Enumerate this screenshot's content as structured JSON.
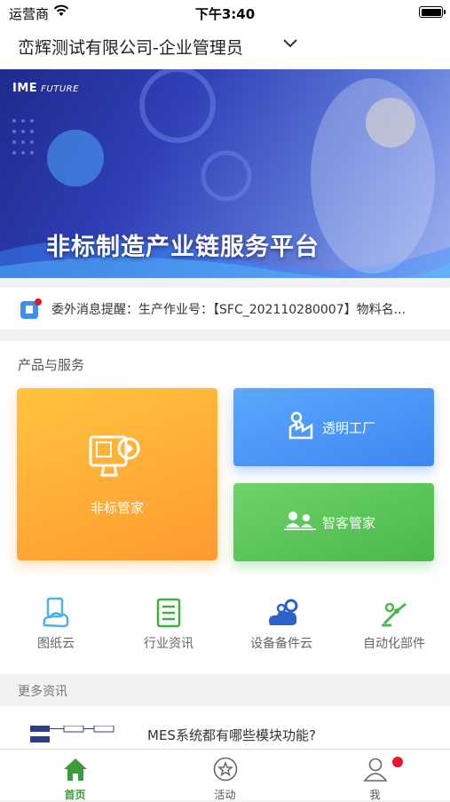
{
  "status_bar": {
    "carrier": "运营商",
    "time": "下午3:40"
  },
  "header": {
    "company": "峦辉测试有限公司-企业管理员"
  },
  "banner": {
    "logo": "IME",
    "logo_sub": "FUTURE",
    "title": "非标制造产业链服务平台"
  },
  "notice": {
    "text": "委外消息提醒：生产作业号：【SFC_202110280007】物料名..."
  },
  "products": {
    "title": "产品与服务",
    "cards": {
      "main": "非标管家",
      "factory": "透明工厂",
      "crm": "智客管家"
    },
    "quick": [
      "图纸云",
      "行业资讯",
      "设备备件云",
      "自动化部件"
    ]
  },
  "more": {
    "title": "更多资讯",
    "article_title": "MES系统都有哪些模块功能?"
  },
  "tabs": [
    "首页",
    "活动",
    "我"
  ],
  "colors": {
    "active_tab": "#3c9b3c",
    "badge": "#e8142c"
  }
}
